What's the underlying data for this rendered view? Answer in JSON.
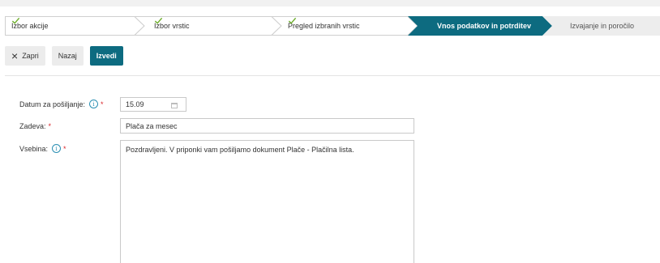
{
  "wizard": {
    "steps": [
      {
        "label": "Izbor akcije",
        "state": "done"
      },
      {
        "label": "Izbor vrstic",
        "state": "done"
      },
      {
        "label": "Pregled izbranih vrstic",
        "state": "done"
      },
      {
        "label": "Vnos podatkov in potrditev",
        "state": "active"
      },
      {
        "label": "Izvajanje in poročilo",
        "state": "todo"
      }
    ]
  },
  "toolbar": {
    "close_label": "Zapri",
    "back_label": "Nazaj",
    "execute_label": "Izvedi"
  },
  "form": {
    "date_label": "Datum za pošiljanje:",
    "date_value": "15.09",
    "subject_label": "Zadeva:",
    "subject_value": "Plača za mesec",
    "body_label": "Vsebina:",
    "body_value": "Pozdravljeni. V priponki vam pošiljamo dokument Plače - Plačilna lista.",
    "required_mark": "*",
    "info_glyph": "i"
  },
  "colors": {
    "active_step": "#0d6b80",
    "check": "#6fae2f",
    "required": "#d9262b",
    "info": "#2a8fb3"
  }
}
